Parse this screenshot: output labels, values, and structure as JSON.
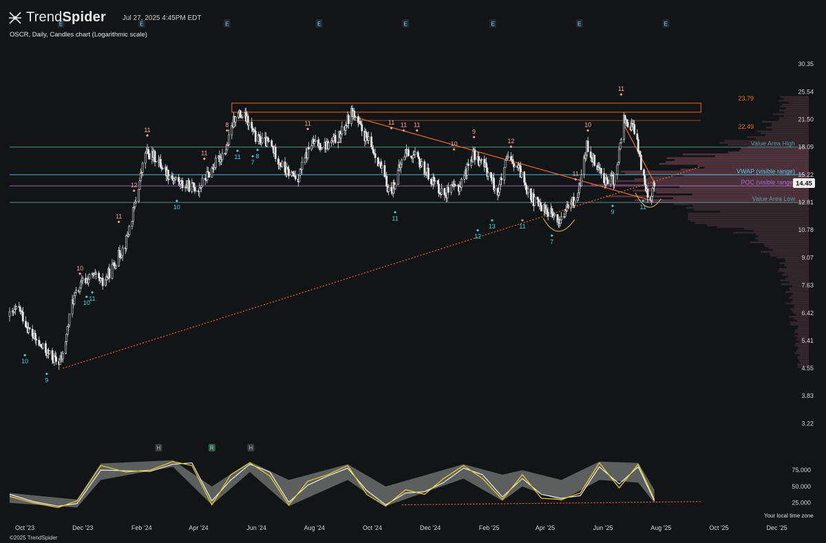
{
  "header": {
    "brand_light": "Trend",
    "brand_bold": "Spider",
    "datetime": "Jul 27, 2025 4:45PM EDT",
    "subtitle": "OSCR, Daily, Candles chart (Logarithmic scale)",
    "timezone_note": "Your local time zone",
    "copyright": "©2025 TrendSpider"
  },
  "colors": {
    "background": "#131416",
    "candle": "#e6e6e6",
    "up_marker": "#f3a6a6",
    "down_marker": "#36d6e7",
    "trendline": "#ef6a25",
    "vwap": "#5cc9e8",
    "poc": "#b06ad0",
    "value_area": "#5f9aa0",
    "oscillator_fast": "#e6d021",
    "oscillator_slow": "#ffffff"
  },
  "chart_data": {
    "type": "candlestick",
    "title": "OSCR, Daily, Candles chart (Logarithmic scale)",
    "y_scale": "log",
    "ylim": [
      2.9,
      35.0
    ],
    "y_ticks": [
      "30.35",
      "25.54",
      "21.50",
      "18.09",
      "15.22",
      "12.81",
      "10.78",
      "9.07",
      "7.63",
      "6.42",
      "5.41",
      "4.55",
      "3.83",
      "3.22"
    ],
    "last_price": "14.45",
    "x_ticks": [
      "Oct '23",
      "Dec '23",
      "Feb '24",
      "Apr '24",
      "Jun '24",
      "Aug '24",
      "Oct '24",
      "Dec '24",
      "Feb '25",
      "Apr '25",
      "Jun '25",
      "Aug '25",
      "Oct '25",
      "Dec '25"
    ],
    "x_range": [
      "2023-09-15",
      "2025-12-31"
    ],
    "earnings_markers": [
      "E",
      "E",
      "E",
      "E",
      "E",
      "E",
      "E",
      "E"
    ],
    "earnings_dates": [
      "2023-11-08",
      "2024-02-01",
      "2024-05-01",
      "2024-08-06",
      "2024-11-05",
      "2025-02-05",
      "2025-05-07",
      "2025-08-06"
    ],
    "price_path": [
      [
        "2023-09-15",
        6.3
      ],
      [
        "2023-09-25",
        6.6
      ],
      [
        "2023-10-05",
        5.8
      ],
      [
        "2023-10-15",
        5.3
      ],
      [
        "2023-10-25",
        5.0
      ],
      [
        "2023-11-05",
        4.7
      ],
      [
        "2023-11-10",
        4.9
      ],
      [
        "2023-11-20",
        6.9
      ],
      [
        "2023-12-01",
        7.8
      ],
      [
        "2023-12-12",
        8.1
      ],
      [
        "2023-12-22",
        7.7
      ],
      [
        "2024-01-03",
        8.7
      ],
      [
        "2024-01-15",
        9.9
      ],
      [
        "2024-01-25",
        12.6
      ],
      [
        "2024-02-05",
        17.5
      ],
      [
        "2024-02-15",
        17.0
      ],
      [
        "2024-03-01",
        15.2
      ],
      [
        "2024-03-15",
        14.3
      ],
      [
        "2024-04-01",
        14.0
      ],
      [
        "2024-04-15",
        15.8
      ],
      [
        "2024-05-01",
        18.1
      ],
      [
        "2024-05-10",
        22.3
      ],
      [
        "2024-05-20",
        21.8
      ],
      [
        "2024-06-01",
        19.0
      ],
      [
        "2024-06-15",
        18.5
      ],
      [
        "2024-07-01",
        15.6
      ],
      [
        "2024-07-15",
        15.0
      ],
      [
        "2024-07-28",
        18.5
      ],
      [
        "2024-08-15",
        18.3
      ],
      [
        "2024-08-28",
        19.4
      ],
      [
        "2024-09-10",
        22.6
      ],
      [
        "2024-09-20",
        20.0
      ],
      [
        "2024-10-05",
        17.2
      ],
      [
        "2024-10-20",
        13.5
      ],
      [
        "2024-11-05",
        17.6
      ],
      [
        "2024-11-15",
        17.0
      ],
      [
        "2024-12-01",
        15.0
      ],
      [
        "2024-12-15",
        13.5
      ],
      [
        "2025-01-01",
        14.2
      ],
      [
        "2025-01-15",
        17.3
      ],
      [
        "2025-01-28",
        16.0
      ],
      [
        "2025-02-10",
        13.6
      ],
      [
        "2025-02-20",
        16.8
      ],
      [
        "2025-03-05",
        15.6
      ],
      [
        "2025-03-20",
        12.9
      ],
      [
        "2025-04-05",
        12.1
      ],
      [
        "2025-04-15",
        11.3
      ],
      [
        "2025-04-25",
        12.4
      ],
      [
        "2025-05-05",
        13.3
      ],
      [
        "2025-05-15",
        18.2
      ],
      [
        "2025-05-25",
        16.3
      ],
      [
        "2025-06-05",
        14.5
      ],
      [
        "2025-06-15",
        15.0
      ],
      [
        "2025-06-22",
        21.6
      ],
      [
        "2025-07-05",
        20.0
      ],
      [
        "2025-07-12",
        15.6
      ],
      [
        "2025-07-20",
        13.0
      ],
      [
        "2025-07-25",
        14.45
      ]
    ],
    "horizontal_levels": [
      {
        "label": "Value Area High",
        "value": 18.09,
        "color": "#5f9aa0"
      },
      {
        "label": "VWAP (visible range)",
        "value": 15.22,
        "color": "#5cc9e8"
      },
      {
        "label": "POC (visible range)",
        "value": 14.2,
        "color": "#b06ad0"
      },
      {
        "label": "Value Area Low",
        "value": 12.81,
        "color": "#5f9aa0"
      }
    ],
    "resistance_box": {
      "start": "2024-05-06",
      "end": "2025-09-12",
      "top": 23.79,
      "bottom": 22.49,
      "labels": [
        "23.79",
        "22.49"
      ]
    },
    "trendlines": [
      {
        "style": "dotted",
        "from": [
          "2023-11-10",
          4.55
        ],
        "to": [
          "2025-09-12",
          16.0
        ]
      },
      {
        "style": "solid",
        "from": [
          "2024-09-10",
          21.9
        ],
        "to": [
          "2025-07-20",
          13.0
        ]
      },
      {
        "style": "solid",
        "from": [
          "2025-06-22",
          21.0
        ],
        "to": [
          "2025-07-25",
          14.5
        ]
      }
    ],
    "sequence_counts_up": [
      {
        "date": "2023-11-28",
        "value": "10",
        "price": 8.1
      },
      {
        "date": "2024-01-08",
        "value": "11",
        "price": 11.2
      },
      {
        "date": "2024-01-24",
        "value": "12",
        "price": 13.6
      },
      {
        "date": "2024-02-07",
        "value": "11",
        "price": 19.2
      },
      {
        "date": "2024-04-07",
        "value": "11",
        "price": 16.6
      },
      {
        "date": "2024-05-01",
        "value": "8",
        "price": 19.8
      },
      {
        "date": "2024-07-25",
        "value": "11",
        "price": 20.0
      },
      {
        "date": "2024-10-21",
        "value": "11",
        "price": 20.1
      },
      {
        "date": "2024-11-03",
        "value": "11",
        "price": 19.8
      },
      {
        "date": "2024-11-17",
        "value": "11",
        "price": 19.8
      },
      {
        "date": "2024-12-26",
        "value": "10",
        "price": 17.6
      },
      {
        "date": "2025-01-16",
        "value": "9",
        "price": 19.0
      },
      {
        "date": "2025-02-24",
        "value": "12",
        "price": 17.9
      },
      {
        "date": "2025-05-03",
        "value": "11",
        "price": 14.6
      },
      {
        "date": "2025-05-16",
        "value": "10",
        "price": 19.8
      },
      {
        "date": "2025-06-20",
        "value": "11",
        "price": 24.8
      }
    ],
    "sequence_counts_down": [
      {
        "date": "2023-10-01",
        "value": "10",
        "price": 5.0
      },
      {
        "date": "2023-10-24",
        "value": "9",
        "price": 4.45
      },
      {
        "date": "2023-12-05",
        "value": "10",
        "price": 7.2
      },
      {
        "date": "2023-12-11",
        "value": "11",
        "price": 7.4
      },
      {
        "date": "2024-03-09",
        "value": "10",
        "price": 13.1
      },
      {
        "date": "2024-05-12",
        "value": "11",
        "price": 17.9
      },
      {
        "date": "2024-05-28",
        "value": "7",
        "price": 17.3
      },
      {
        "date": "2024-06-02",
        "value": "8",
        "price": 18.0
      },
      {
        "date": "2024-10-25",
        "value": "11",
        "price": 12.2
      },
      {
        "date": "2025-01-20",
        "value": "12",
        "price": 10.9
      },
      {
        "date": "2025-02-04",
        "value": "13",
        "price": 11.6
      },
      {
        "date": "2025-03-08",
        "value": "11",
        "price": 11.6
      },
      {
        "date": "2025-04-08",
        "value": "7",
        "price": 10.55
      },
      {
        "date": "2025-06-11",
        "value": "9",
        "price": 12.7
      },
      {
        "date": "2025-07-13",
        "value": "11",
        "price": 13.1
      }
    ],
    "oscillator": {
      "ylim": [
        10,
        95
      ],
      "y_ticks": [
        "75.000",
        "50.000",
        "25.000"
      ],
      "fast": [
        [
          "2023-09-15",
          35
        ],
        [
          "2023-10-10",
          25
        ],
        [
          "2023-11-05",
          18
        ],
        [
          "2023-11-25",
          28
        ],
        [
          "2023-12-20",
          82
        ],
        [
          "2024-01-15",
          72
        ],
        [
          "2024-02-10",
          75
        ],
        [
          "2024-03-05",
          88
        ],
        [
          "2024-03-25",
          82
        ],
        [
          "2024-04-15",
          22
        ],
        [
          "2024-05-05",
          68
        ],
        [
          "2024-05-25",
          86
        ],
        [
          "2024-06-15",
          66
        ],
        [
          "2024-07-05",
          22
        ],
        [
          "2024-07-25",
          58
        ],
        [
          "2024-08-15",
          68
        ],
        [
          "2024-09-05",
          82
        ],
        [
          "2024-09-25",
          38
        ],
        [
          "2024-10-15",
          20
        ],
        [
          "2024-11-05",
          45
        ],
        [
          "2024-11-25",
          38
        ],
        [
          "2024-12-15",
          62
        ],
        [
          "2025-01-05",
          82
        ],
        [
          "2025-01-25",
          62
        ],
        [
          "2025-02-15",
          30
        ],
        [
          "2025-03-08",
          68
        ],
        [
          "2025-03-28",
          32
        ],
        [
          "2025-04-18",
          30
        ],
        [
          "2025-05-08",
          40
        ],
        [
          "2025-05-28",
          86
        ],
        [
          "2025-06-18",
          48
        ],
        [
          "2025-07-08",
          84
        ],
        [
          "2025-07-25",
          30
        ]
      ],
      "slow": [
        [
          "2023-09-15",
          38
        ],
        [
          "2023-10-10",
          27
        ],
        [
          "2023-11-05",
          20
        ],
        [
          "2023-11-25",
          24
        ],
        [
          "2023-12-20",
          75
        ],
        [
          "2024-01-15",
          74
        ],
        [
          "2024-02-10",
          73
        ],
        [
          "2024-03-05",
          84
        ],
        [
          "2024-03-25",
          86
        ],
        [
          "2024-04-15",
          28
        ],
        [
          "2024-05-05",
          60
        ],
        [
          "2024-05-25",
          84
        ],
        [
          "2024-06-15",
          72
        ],
        [
          "2024-07-05",
          26
        ],
        [
          "2024-07-25",
          52
        ],
        [
          "2024-08-15",
          66
        ],
        [
          "2024-09-05",
          78
        ],
        [
          "2024-09-25",
          44
        ],
        [
          "2024-10-15",
          22
        ],
        [
          "2024-11-05",
          40
        ],
        [
          "2024-11-25",
          42
        ],
        [
          "2024-12-15",
          56
        ],
        [
          "2025-01-05",
          78
        ],
        [
          "2025-01-25",
          68
        ],
        [
          "2025-02-15",
          34
        ],
        [
          "2025-03-08",
          62
        ],
        [
          "2025-03-28",
          38
        ],
        [
          "2025-04-18",
          32
        ],
        [
          "2025-05-08",
          36
        ],
        [
          "2025-05-28",
          80
        ],
        [
          "2025-06-18",
          54
        ],
        [
          "2025-07-08",
          80
        ],
        [
          "2025-07-25",
          28
        ]
      ],
      "band_upper": [
        [
          "2023-09-15",
          40
        ],
        [
          "2023-11-25",
          30
        ],
        [
          "2023-12-20",
          85
        ],
        [
          "2024-03-05",
          90
        ],
        [
          "2024-04-15",
          50
        ],
        [
          "2024-05-25",
          88
        ],
        [
          "2024-07-05",
          60
        ],
        [
          "2024-09-05",
          84
        ],
        [
          "2024-10-15",
          50
        ],
        [
          "2025-01-05",
          84
        ],
        [
          "2025-02-15",
          68
        ],
        [
          "2025-03-08",
          75
        ],
        [
          "2025-04-18",
          60
        ],
        [
          "2025-05-28",
          88
        ],
        [
          "2025-07-08",
          86
        ],
        [
          "2025-07-25",
          45
        ]
      ],
      "band_lower": [
        [
          "2023-09-15",
          25
        ],
        [
          "2023-11-25",
          18
        ],
        [
          "2023-12-20",
          60
        ],
        [
          "2024-03-05",
          80
        ],
        [
          "2024-04-15",
          22
        ],
        [
          "2024-05-25",
          72
        ],
        [
          "2024-07-05",
          20
        ],
        [
          "2024-09-05",
          60
        ],
        [
          "2024-10-15",
          20
        ],
        [
          "2025-01-05",
          62
        ],
        [
          "2025-02-15",
          28
        ],
        [
          "2025-03-08",
          50
        ],
        [
          "2025-04-18",
          28
        ],
        [
          "2025-05-28",
          60
        ],
        [
          "2025-07-08",
          56
        ],
        [
          "2025-07-25",
          25
        ]
      ],
      "trendline": {
        "from": [
          "2024-11-01",
          22
        ],
        "to": [
          "2025-09-12",
          27
        ]
      },
      "divergence_markers": [
        {
          "label": "H",
          "date": "2024-02-19"
        },
        {
          "label": "R",
          "date": "2024-04-15"
        },
        {
          "label": "H",
          "date": "2024-05-26"
        }
      ]
    }
  }
}
